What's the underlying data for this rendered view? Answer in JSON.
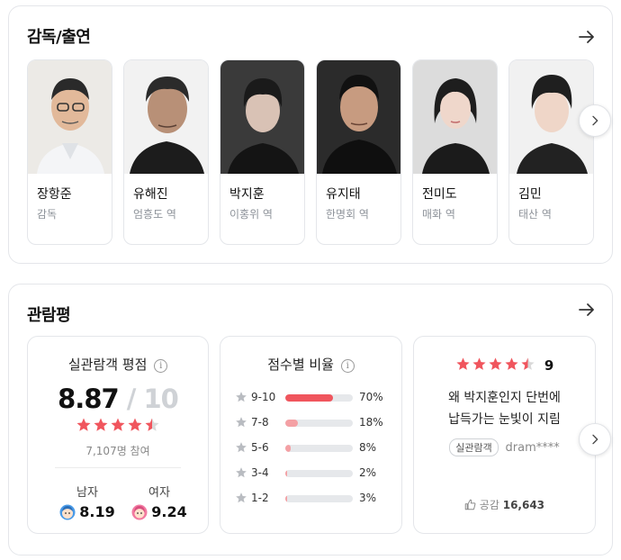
{
  "cast_section": {
    "title": "감독/출연",
    "people": [
      {
        "name": "장항준",
        "role": "감독"
      },
      {
        "name": "유해진",
        "role": "엄흥도 역"
      },
      {
        "name": "박지훈",
        "role": "이홍위 역"
      },
      {
        "name": "유지태",
        "role": "한명회 역"
      },
      {
        "name": "전미도",
        "role": "매화 역"
      },
      {
        "name": "김민",
        "role": "태산 역"
      }
    ]
  },
  "review_section": {
    "title": "관람평",
    "score_box": {
      "title": "실관람객 평점",
      "score": "8.87",
      "slash": "/",
      "max": "10",
      "rating_stars": 4.5,
      "participants": "7,107명 참여",
      "male_label": "남자",
      "male_score": "8.19",
      "female_label": "여자",
      "female_score": "9.24"
    },
    "dist_box": {
      "title": "점수별 비율",
      "rows": [
        {
          "range": "9-10",
          "percent": "70%",
          "value": 70
        },
        {
          "range": "7-8",
          "percent": "18%",
          "value": 18
        },
        {
          "range": "5-6",
          "percent": "8%",
          "value": 8
        },
        {
          "range": "3-4",
          "percent": "2%",
          "value": 2
        },
        {
          "range": "1-2",
          "percent": "3%",
          "value": 3
        }
      ]
    },
    "review_box": {
      "rating_stars": 4.5,
      "score": "9",
      "text_line1": "왜 박지훈인지 단번에",
      "text_line2": "납득가는 눈빛이 지림",
      "badge": "실관람객",
      "user": "dram****",
      "like_label": "공감",
      "like_count": "16,643"
    }
  },
  "colors": {
    "accent_red": "#f0555d",
    "bar_light": "#f4a0a4",
    "star_gray": "#b9bcc1",
    "male_blue": "#4a9be8",
    "female_pink": "#f27aa0"
  },
  "icons": [
    "arrow-right-icon",
    "chevron-right-icon",
    "info-icon",
    "star-icon",
    "male-face-icon",
    "female-face-icon",
    "thumbs-up-icon"
  ]
}
